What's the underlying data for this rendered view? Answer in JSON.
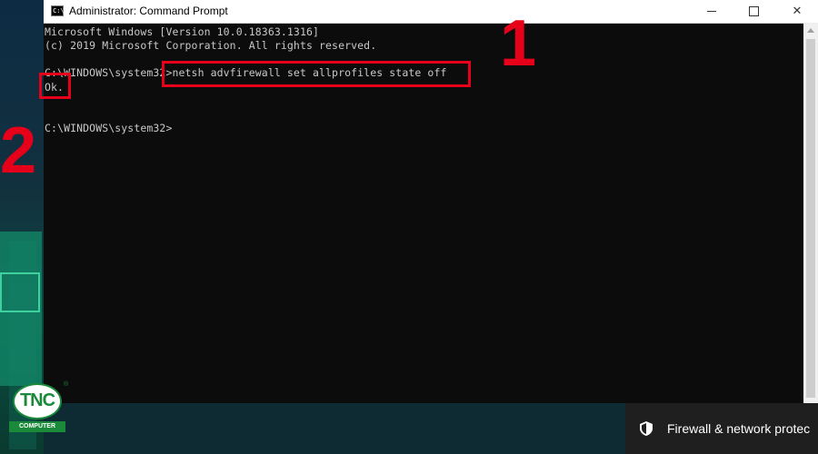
{
  "window": {
    "title": "Administrator: Command Prompt",
    "icon_label": "C:\\",
    "controls": {
      "minimize": "minimize",
      "maximize": "maximize",
      "close": "✕"
    }
  },
  "console": {
    "lines": [
      "Microsoft Windows [Version 10.0.18363.1316]",
      "(c) 2019 Microsoft Corporation. All rights reserved.",
      "",
      "C:\\WINDOWS\\system32>netsh advfirewall set allprofiles state off",
      "Ok.",
      "",
      "C:\\WINDOWS\\system32>"
    ]
  },
  "annotations": {
    "step1": "1",
    "step2": "2"
  },
  "notification": {
    "text": "Firewall & network protec",
    "icon": "shield-icon"
  },
  "logo": {
    "name": "TNC",
    "subtitle": "COMPUTER",
    "mark": "®"
  },
  "colors": {
    "annotation": "#e6001a",
    "console_bg": "#0c0c0c",
    "console_text": "#c8c8c8",
    "logo_green": "#1a8a3a"
  }
}
